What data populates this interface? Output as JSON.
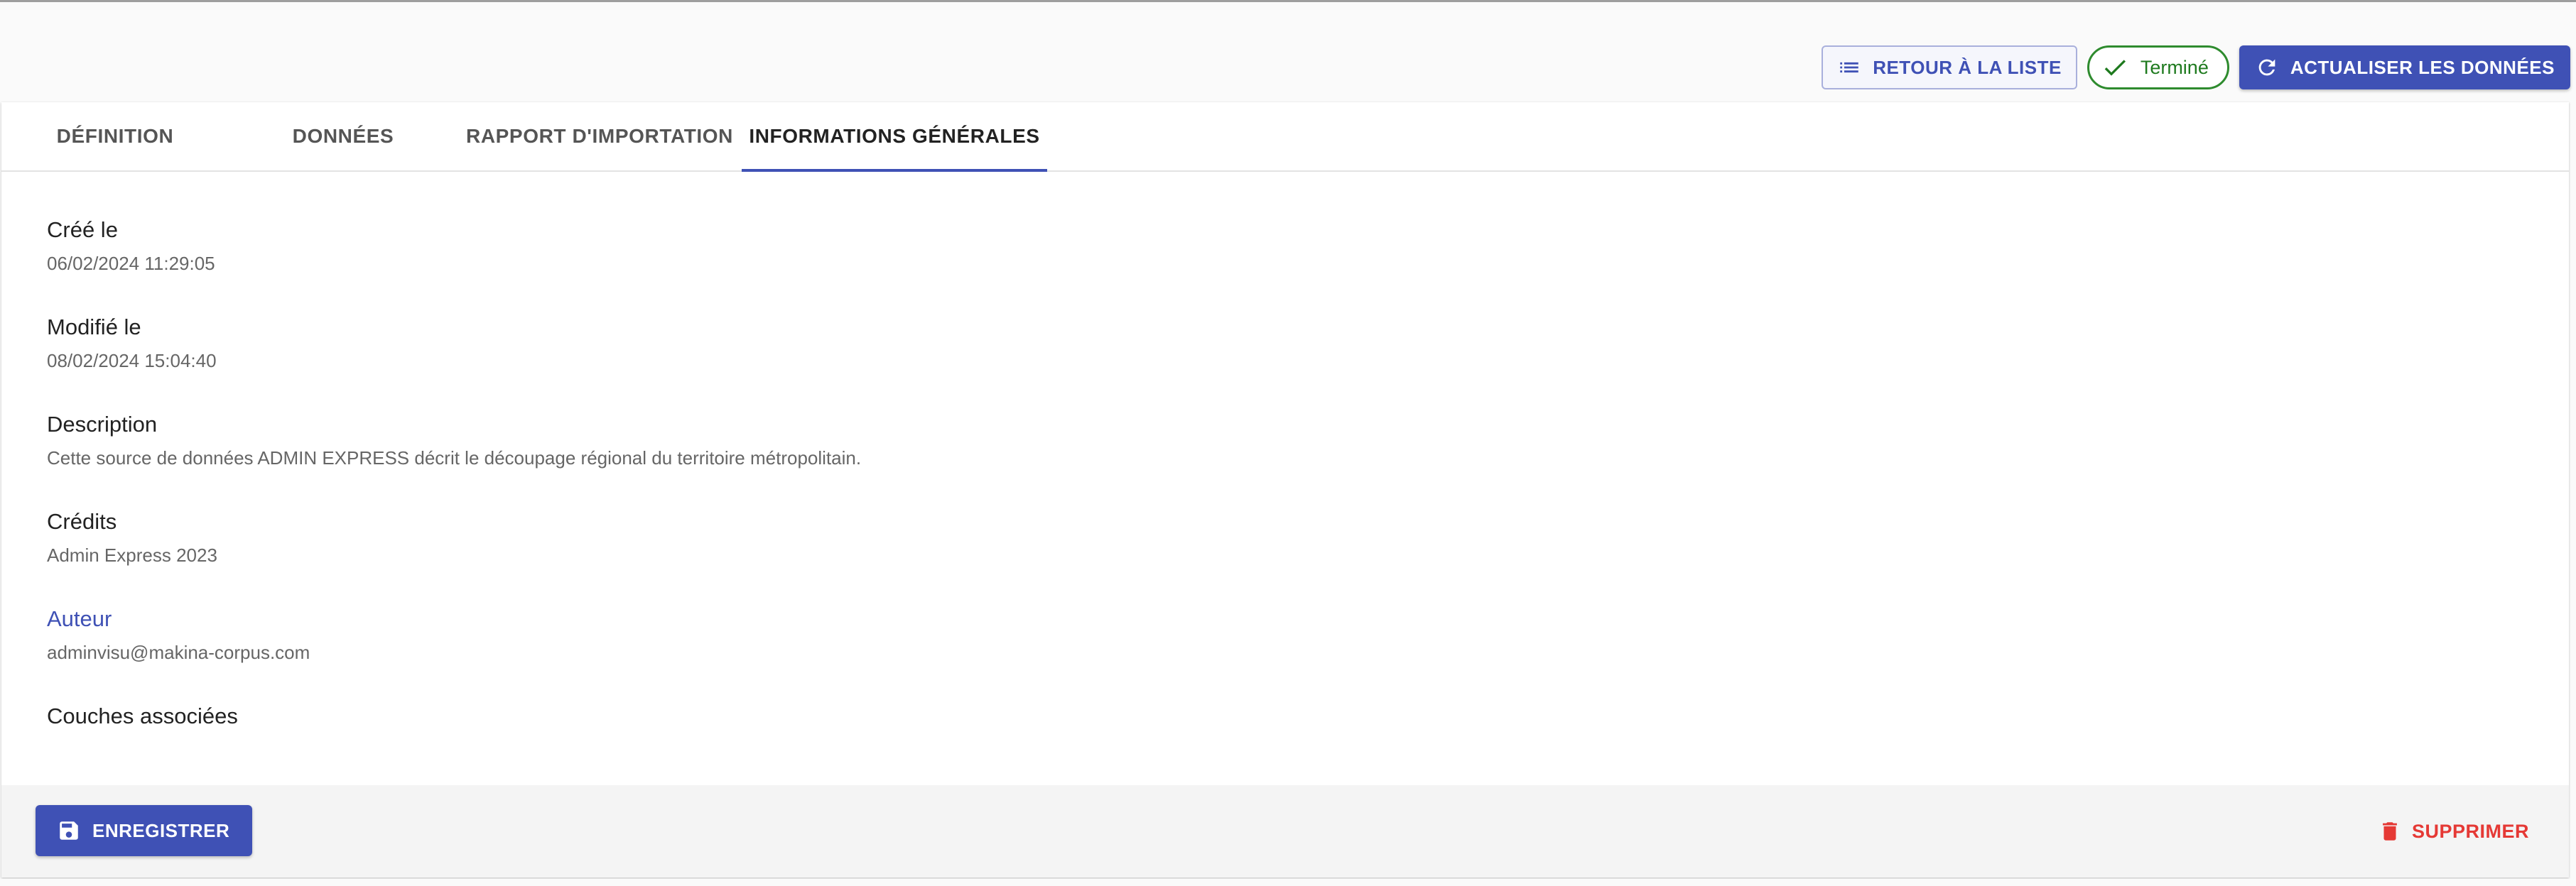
{
  "header": {
    "back_label": "RETOUR À LA LISTE",
    "status_label": "Terminé",
    "refresh_label": "ACTUALISER LES DONNÉES"
  },
  "tabs": [
    {
      "label": "DÉFINITION",
      "active": false
    },
    {
      "label": "DONNÉES",
      "active": false
    },
    {
      "label": "RAPPORT D'IMPORTATION",
      "active": false
    },
    {
      "label": "INFORMATIONS GÉNÉRALES",
      "active": true
    }
  ],
  "fields": {
    "created": {
      "label": "Créé le",
      "value": "06/02/2024 11:29:05"
    },
    "modified": {
      "label": "Modifié le",
      "value": "08/02/2024 15:04:40"
    },
    "description": {
      "label": "Description",
      "value": "Cette source de données ADMIN EXPRESS décrit le découpage régional du territoire métropolitain."
    },
    "credits": {
      "label": "Crédits",
      "value": "Admin Express 2023"
    },
    "author": {
      "label": "Auteur",
      "value": "adminvisu@makina-corpus.com"
    },
    "layers": {
      "label": "Couches associées"
    }
  },
  "footer": {
    "save_label": "ENREGISTRER",
    "delete_label": "SUPPRIMER"
  },
  "colors": {
    "primary": "#3f51b5",
    "success": "#2e8b2e",
    "danger": "#e53935"
  }
}
